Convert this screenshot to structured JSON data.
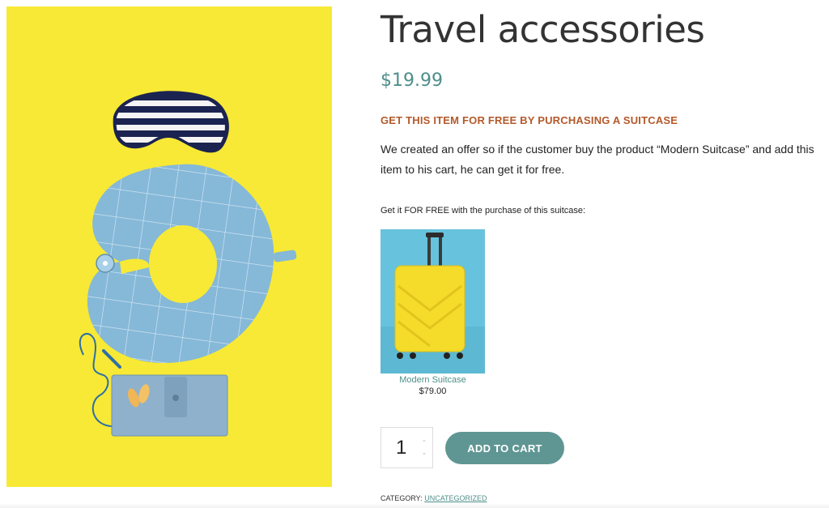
{
  "product": {
    "title": "Travel accessories",
    "price": "$19.99",
    "image_description_icon": "travel-accessories-photo"
  },
  "offer": {
    "heading": "GET THIS ITEM FOR FREE BY PURCHASING A SUITCASE",
    "description": "We created an offer so if the customer buy the product “Modern Suitcase” and add this item to his cart, he can get it for free.",
    "free_label": "Get it FOR FREE with the purchase of this suitcase:",
    "card": {
      "name": "Modern Suitcase",
      "price": "$79.00"
    }
  },
  "cart": {
    "quantity": "1",
    "up_glyph": "⌃",
    "down_glyph": "⌄",
    "button_label": "ADD TO CART"
  },
  "meta": {
    "category_label": "CATEGORY:",
    "category_value": "UNCATEGORIZED"
  },
  "colors": {
    "accent_teal": "#4e8f8a",
    "button_teal": "#5f9693",
    "offer_orange": "#b3592a",
    "image_yellow": "#f7e935",
    "suitcase_bg": "#67c3dd"
  }
}
